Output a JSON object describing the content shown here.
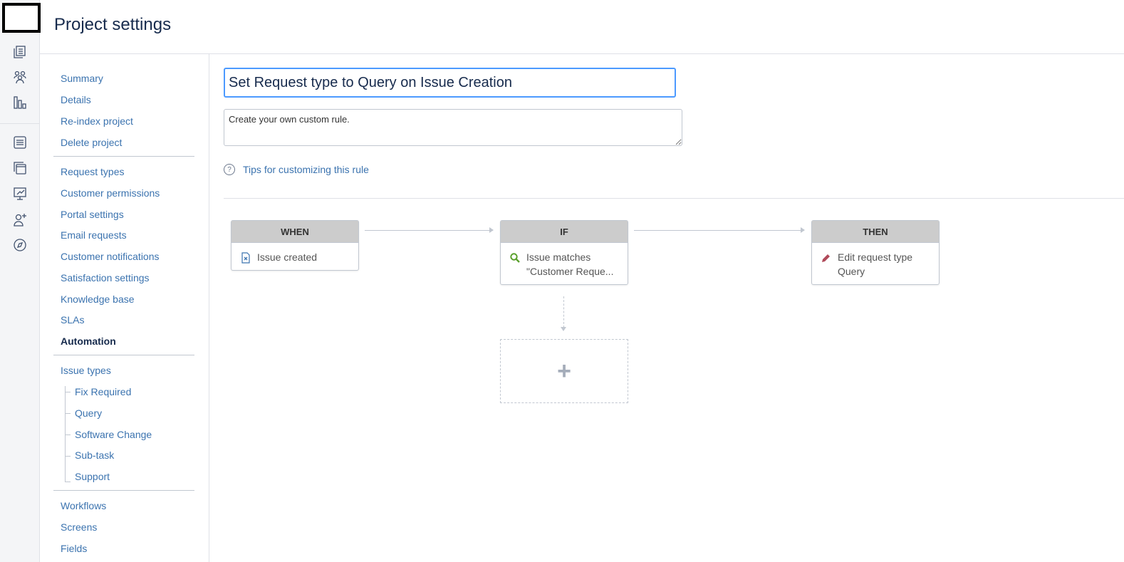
{
  "header": {
    "title": "Project settings"
  },
  "rail": {
    "icons": [
      "logo",
      "queues-icon",
      "customers-icon",
      "reports-icon",
      "knowledge-icon",
      "raise-request-icon",
      "channels-icon",
      "invite-team-icon",
      "compass-icon"
    ]
  },
  "nav": {
    "group1": [
      "Summary",
      "Details",
      "Re-index project",
      "Delete project"
    ],
    "group2": [
      "Request types",
      "Customer permissions",
      "Portal settings",
      "Email requests",
      "Customer notifications",
      "Satisfaction settings",
      "Knowledge base",
      "SLAs"
    ],
    "current": "Automation",
    "issue_types": "Issue types",
    "issue_type_children": [
      "Fix Required",
      "Query",
      "Software Change",
      "Sub-task",
      "Support"
    ],
    "group4": [
      "Workflows",
      "Screens",
      "Fields"
    ]
  },
  "rule": {
    "name_value": "Set Request type to Query on Issue Creation",
    "description_value": "Create your own custom rule.",
    "tips_label": "Tips for customizing this rule"
  },
  "builder": {
    "when": {
      "header": "WHEN",
      "line1": "Issue created"
    },
    "if": {
      "header": "IF",
      "line1": "Issue matches",
      "line2": "\"Customer Reque..."
    },
    "then": {
      "header": "THEN",
      "line1": "Edit request type",
      "line2": "Query"
    },
    "add_symbol": "+"
  },
  "colors": {
    "link": "#3b73af",
    "focus": "#4c9aff",
    "card_header": "#cccccc"
  }
}
